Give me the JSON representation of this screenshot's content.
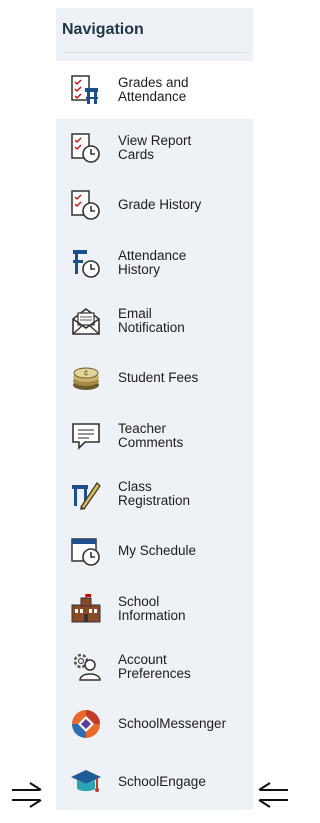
{
  "nav": {
    "title": "Navigation",
    "items": [
      {
        "label": "Grades and\nAttendance",
        "icon": "grades-attendance-icon"
      },
      {
        "label": "View Report\nCards",
        "icon": "report-cards-icon"
      },
      {
        "label": "Grade History",
        "icon": "grade-history-icon"
      },
      {
        "label": "Attendance\nHistory",
        "icon": "attendance-history-icon"
      },
      {
        "label": "Email\nNotification",
        "icon": "email-icon"
      },
      {
        "label": "Student Fees",
        "icon": "fees-icon"
      },
      {
        "label": "Teacher\nComments",
        "icon": "comments-icon"
      },
      {
        "label": "Class\nRegistration",
        "icon": "registration-icon"
      },
      {
        "label": "My Schedule",
        "icon": "schedule-icon"
      },
      {
        "label": "School\nInformation",
        "icon": "school-icon"
      },
      {
        "label": "Account\nPreferences",
        "icon": "account-preferences-icon"
      },
      {
        "label": "SchoolMessenger",
        "icon": "schoolmessenger-logo-icon"
      },
      {
        "label": "SchoolEngage",
        "icon": "schoolengage-logo-icon"
      }
    ]
  },
  "colors": {
    "panel": "#eef2f6",
    "active": "#ffffff",
    "accent_blue": "#1d4f8c"
  }
}
